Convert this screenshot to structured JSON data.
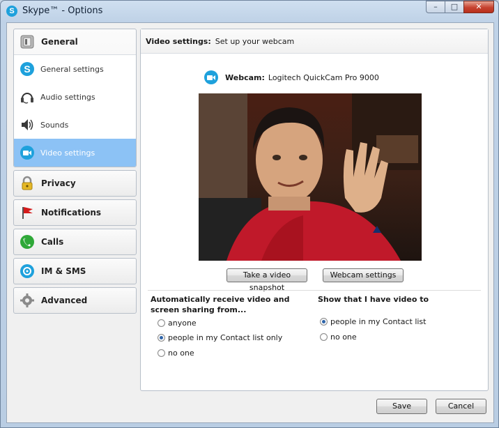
{
  "window": {
    "title": "Skype™ - Options",
    "app_glyph": "S",
    "minimize_glyph": "–",
    "maximize_glyph": "□",
    "close_glyph": "✕"
  },
  "nav": {
    "general": {
      "label": "General",
      "icon": "general-switch-icon",
      "items": [
        {
          "label": "General settings",
          "icon": "skype-logo-icon",
          "selected": false
        },
        {
          "label": "Audio settings",
          "icon": "headset-icon",
          "selected": false
        },
        {
          "label": "Sounds",
          "icon": "speaker-icon",
          "selected": false
        },
        {
          "label": "Video settings",
          "icon": "video-camera-icon",
          "selected": true
        }
      ]
    },
    "privacy": {
      "label": "Privacy",
      "icon": "padlock-icon"
    },
    "notifications": {
      "label": "Notifications",
      "icon": "red-flag-icon"
    },
    "calls": {
      "label": "Calls",
      "icon": "phone-icon"
    },
    "im_sms": {
      "label": "IM & SMS",
      "icon": "chat-icon"
    },
    "advanced": {
      "label": "Advanced",
      "icon": "gear-icon"
    }
  },
  "panel": {
    "title": "Video settings:",
    "subtitle": "Set up your webcam",
    "webcam_label": "Webcam:",
    "webcam_name": "Logitech QuickCam Pro 9000",
    "snapshot_button": "Take a video snapshot",
    "webcam_settings_button": "Webcam settings"
  },
  "receive": {
    "title": "Automatically receive video and screen sharing from...",
    "options": [
      {
        "label": "anyone",
        "checked": false
      },
      {
        "label": "people in my Contact list only",
        "checked": true
      },
      {
        "label": "no one",
        "checked": false
      }
    ]
  },
  "show": {
    "title": "Show that I have video to",
    "options": [
      {
        "label": "people in my Contact list",
        "checked": true
      },
      {
        "label": "no one",
        "checked": false
      }
    ]
  },
  "footer": {
    "save": "Save",
    "cancel": "Cancel"
  },
  "colors": {
    "selected_nav": "#8cc2f5",
    "skype_blue": "#1ea1dc",
    "calls_green": "#2fa838"
  }
}
